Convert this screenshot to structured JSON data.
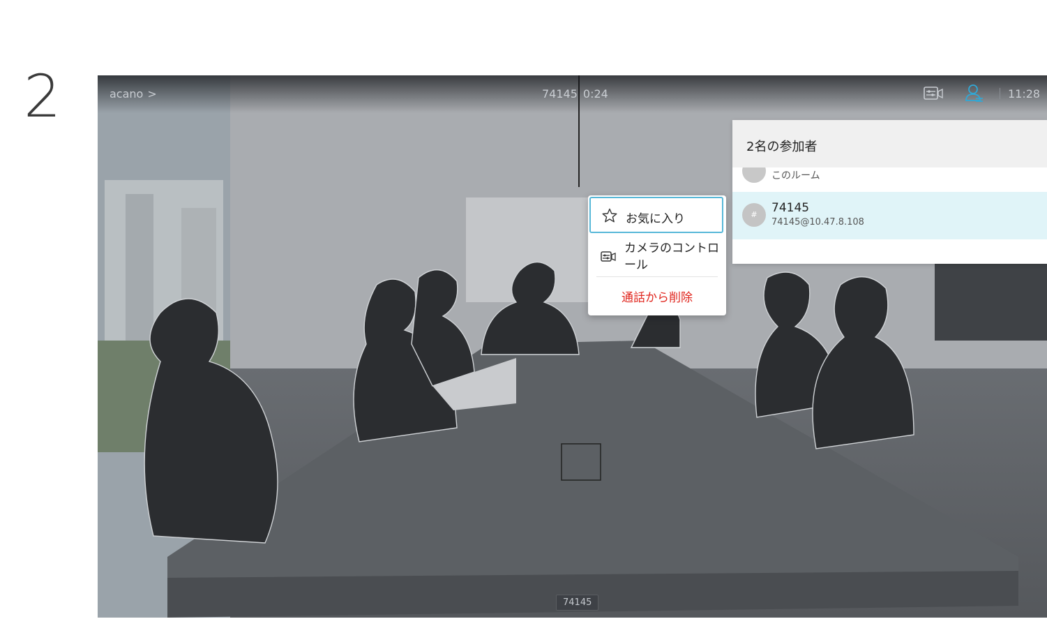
{
  "step": {
    "number": "2"
  },
  "call": {
    "site_name": "acano",
    "site_chevron": ">",
    "number": "74145",
    "duration": "0:24",
    "time": "11:28",
    "bottom_tag": "74145"
  },
  "participants_panel": {
    "title": "2名の参加者",
    "items": [
      {
        "label": "このルーム"
      },
      {
        "name": "74145",
        "address": "74145@10.47.8.108",
        "avatar": "#"
      }
    ]
  },
  "context_menu": {
    "items": [
      {
        "label": "お気に入り",
        "icon": "star-outline-icon"
      },
      {
        "label": "カメラのコントロール",
        "icon": "camera-control-icon"
      },
      {
        "label": "通話から削除"
      }
    ]
  },
  "colors": {
    "accent": "#57b8d8",
    "danger": "#e0261e",
    "selected_row": "#e0f4f8"
  }
}
